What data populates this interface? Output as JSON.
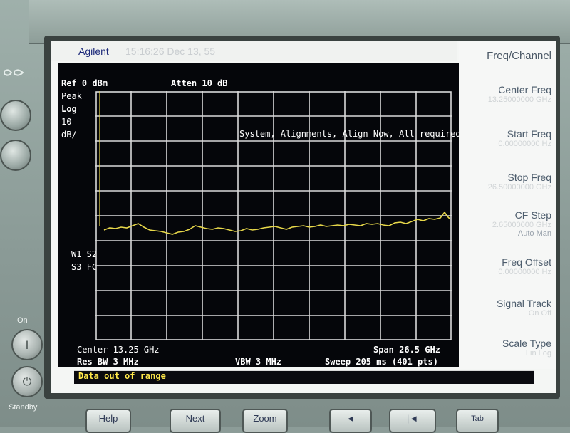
{
  "header": {
    "brand": "Agilent",
    "datetime": "15:16:26  Dec 13, 55"
  },
  "display": {
    "ref_level": "Ref 0 dBm",
    "attenuation": "Atten 10 dB",
    "detector": "Peak",
    "scale_type": "Log",
    "scale_value": "10",
    "scale_unit": "dB/",
    "markers_line1": "W1  S2",
    "markers_line2": "S3  FC",
    "alignment_notice": "System, Alignments, Align Now, All required",
    "center": "Center 13.25 GHz",
    "span": "Span 26.5 GHz",
    "res_bw": "Res BW 3 MHz",
    "vbw": "VBW 3 MHz",
    "sweep": "Sweep 205 ms (401 pts)",
    "message": "Data out of range"
  },
  "softkey_menu": {
    "title": "Freq/Channel",
    "keys": [
      {
        "label": "Center Freq",
        "value": "13.25000000 GHz"
      },
      {
        "label": "Start Freq",
        "value": "0.00000000 Hz"
      },
      {
        "label": "Stop Freq",
        "value": "26.50000000 GHz"
      },
      {
        "label": "CF Step",
        "value": "2.65000000 GHz",
        "sub": "Auto        Man"
      },
      {
        "label": "Freq Offset",
        "value": "0.00000000 Hz"
      },
      {
        "label": "Signal Track",
        "value": "On         Off"
      },
      {
        "label": "Scale Type",
        "value": "Lin         Log"
      }
    ]
  },
  "front_panel": {
    "on_label": "On",
    "standby_label": "Standby",
    "keys": [
      "Help",
      "Next",
      "Zoom",
      "Tab"
    ]
  },
  "colors": {
    "trace": "#e8d84a",
    "screen_bg": "#05060a",
    "message_text": "#ffe84a",
    "grid": "#d9d9d9"
  }
}
